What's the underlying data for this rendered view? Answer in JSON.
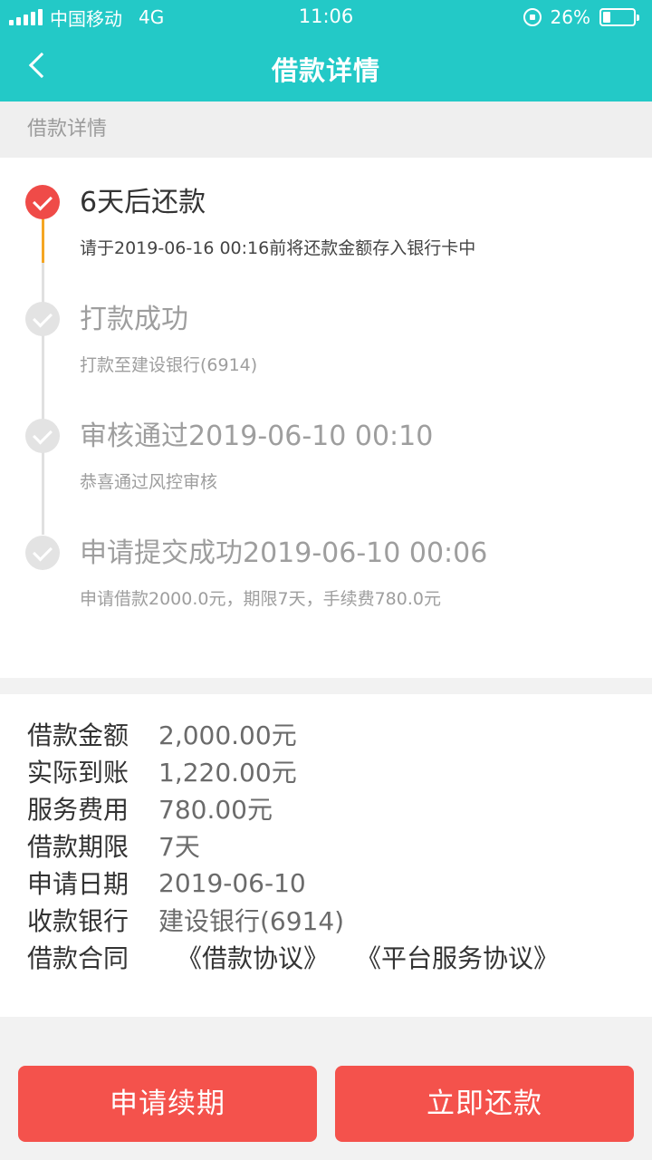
{
  "status_bar": {
    "carrier": "中国移动",
    "network": "4G",
    "time": "11:06",
    "battery": "26%"
  },
  "nav": {
    "title": "借款详情"
  },
  "section_label": "借款详情",
  "timeline": [
    {
      "title": "6天后还款",
      "desc": "请于2019-06-16 00:16前将还款金额存入银行卡中",
      "active": true
    },
    {
      "title": "打款成功",
      "desc": "打款至建设银行(6914)",
      "active": false
    },
    {
      "title": "审核通过2019-06-10 00:10",
      "desc": "恭喜通过风控审核",
      "active": false
    },
    {
      "title": "申请提交成功2019-06-10 00:06",
      "desc": "申请借款2000.0元，期限7天，手续费780.0元",
      "active": false
    }
  ],
  "details": [
    {
      "label": "借款金额",
      "value": "2,000.00元"
    },
    {
      "label": "实际到账",
      "value": "1,220.00元"
    },
    {
      "label": "服务费用",
      "value": "780.00元"
    },
    {
      "label": "借款期限",
      "value": "7天"
    },
    {
      "label": "申请日期",
      "value": "2019-06-10"
    },
    {
      "label": "收款银行",
      "value": "建设银行(6914)"
    }
  ],
  "contract": {
    "label": "借款合同",
    "links": [
      "《借款协议》",
      "《平台服务协议》"
    ]
  },
  "buttons": {
    "renew": "申请续期",
    "repay": "立即还款"
  },
  "colors": {
    "header": "#23c9c7",
    "accent_red": "#f4524c",
    "progress_orange": "#f5a623"
  }
}
